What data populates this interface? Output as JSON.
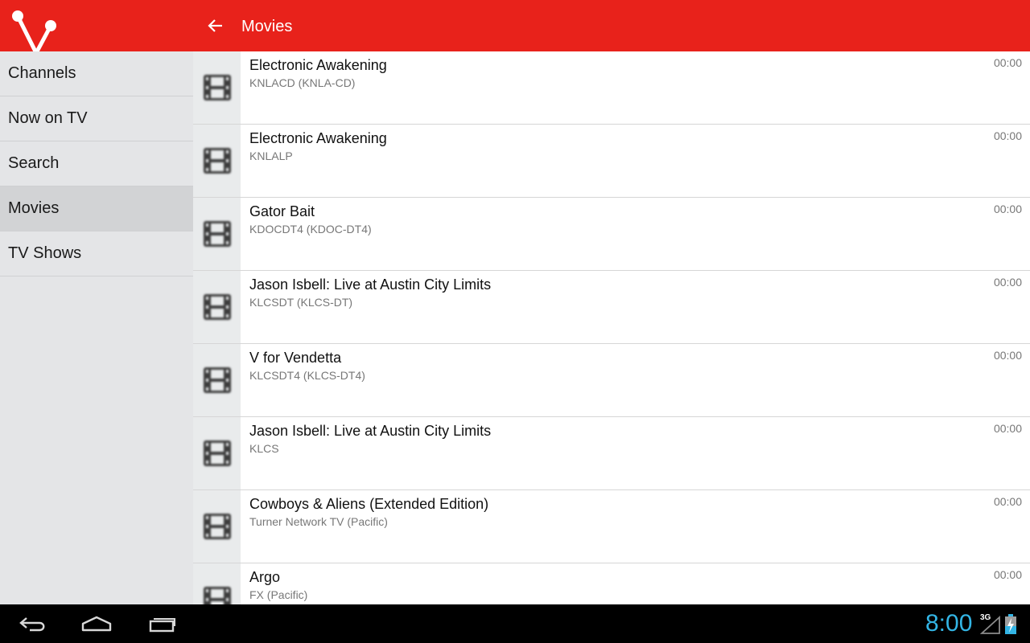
{
  "header": {
    "title": "Movies"
  },
  "sidebar": {
    "items": [
      {
        "label": "Channels",
        "active": false
      },
      {
        "label": "Now on TV",
        "active": false
      },
      {
        "label": "Search",
        "active": false
      },
      {
        "label": "Movies",
        "active": true
      },
      {
        "label": "TV Shows",
        "active": false
      }
    ]
  },
  "movies": [
    {
      "title": "Electronic Awakening",
      "channel": "KNLACD (KNLA-CD)",
      "time": "00:00"
    },
    {
      "title": "Electronic Awakening",
      "channel": "KNLALP",
      "time": "00:00"
    },
    {
      "title": "Gator Bait",
      "channel": "KDOCDT4 (KDOC-DT4)",
      "time": "00:00"
    },
    {
      "title": "Jason Isbell: Live at Austin City Limits",
      "channel": "KLCSDT (KLCS-DT)",
      "time": "00:00"
    },
    {
      "title": "V for Vendetta",
      "channel": "KLCSDT4 (KLCS-DT4)",
      "time": "00:00"
    },
    {
      "title": "Jason Isbell: Live at Austin City Limits",
      "channel": "KLCS",
      "time": "00:00"
    },
    {
      "title": "Cowboys & Aliens (Extended Edition)",
      "channel": "Turner Network TV (Pacific)",
      "time": "00:00"
    },
    {
      "title": "Argo",
      "channel": "FX (Pacific)",
      "time": "00:00"
    }
  ],
  "statusbar": {
    "clock": "8:00",
    "network": "3G"
  },
  "icons": {
    "logo": "antenna-logo-icon",
    "back": "arrow-left-icon",
    "thumbnail": "film-icon",
    "nav_back": "back-icon",
    "nav_home": "home-icon",
    "nav_recents": "recent-apps-icon"
  },
  "colors": {
    "accent": "#e8221b",
    "sidebar_bg": "#e4e5e7",
    "sidebar_active": "#d2d3d5",
    "clock": "#33b5e5"
  }
}
